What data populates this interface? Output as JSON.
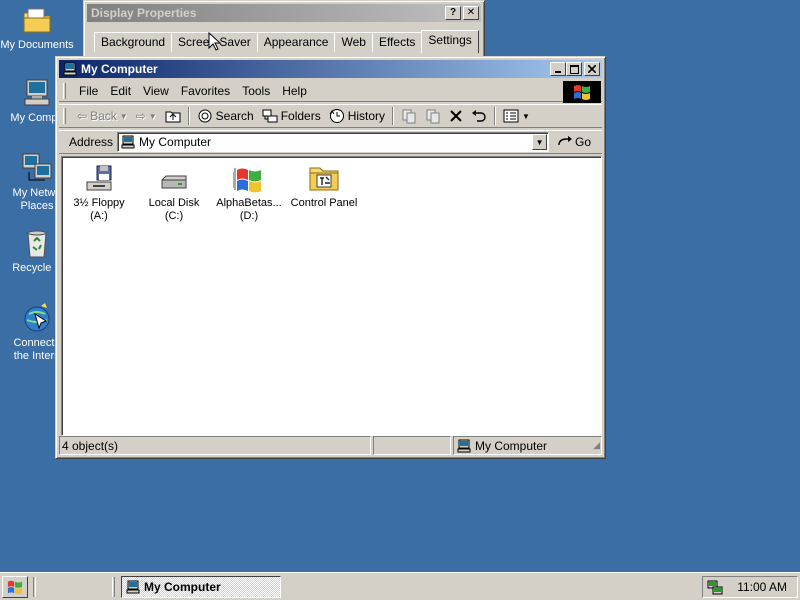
{
  "desktop": {
    "icons": [
      {
        "label": "My Documents",
        "icon": "folder-icon"
      },
      {
        "label": "My Compu",
        "icon": "computer-icon"
      },
      {
        "label": "My Netwo\nPlaces",
        "icon": "network-icon"
      },
      {
        "label": "Recycle B",
        "icon": "recycle-bin-icon"
      },
      {
        "label": "Connect t\nthe Intern",
        "icon": "internet-connect-icon"
      }
    ]
  },
  "display_properties": {
    "title": "Display Properties",
    "help_btn": "?",
    "close_btn": "✕",
    "tabs": [
      "Background",
      "Screen Saver",
      "Appearance",
      "Web",
      "Effects",
      "Settings"
    ],
    "selected_tab": "Settings"
  },
  "my_computer": {
    "title": "My Computer",
    "menu": [
      "File",
      "Edit",
      "View",
      "Favorites",
      "Tools",
      "Help"
    ],
    "toolbar": {
      "back": "Back",
      "search": "Search",
      "folders": "Folders",
      "history": "History"
    },
    "address": {
      "label": "Address",
      "value": "My Computer",
      "go": "Go"
    },
    "items": [
      {
        "label": "3½ Floppy\n(A:)",
        "icon": "floppy-drive-icon"
      },
      {
        "label": "Local Disk (C:)",
        "icon": "hard-disk-icon"
      },
      {
        "label": "AlphaBetas...\n(D:)",
        "icon": "cd-drive-icon"
      },
      {
        "label": "Control Panel",
        "icon": "control-panel-icon"
      }
    ],
    "status": {
      "count": "4 object(s)",
      "location": "My Computer"
    }
  },
  "taskbar": {
    "task": "My Computer",
    "clock": "11:00 AM"
  },
  "colors": {
    "desktop": "#3a6ea5",
    "title_active": "#0a246a",
    "face": "#d4d0c8"
  }
}
